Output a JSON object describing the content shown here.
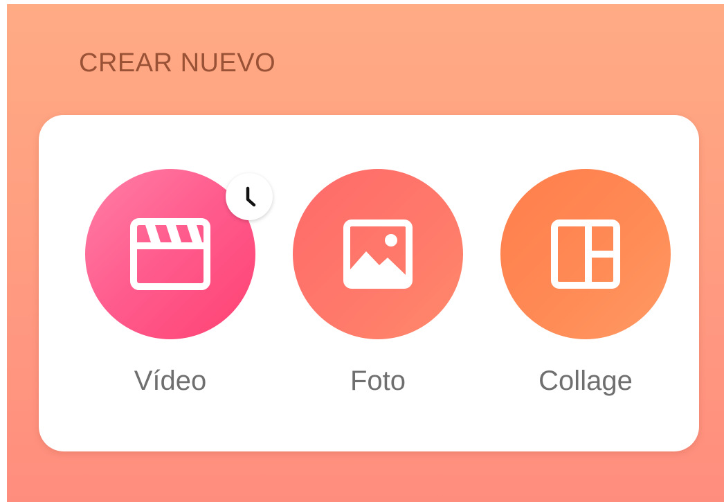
{
  "section": {
    "title": "CREAR NUEVO"
  },
  "options": [
    {
      "label": "Vídeo",
      "icon": "clapperboard-icon",
      "color": "#ff5a8c",
      "badge_icon": "clock-icon"
    },
    {
      "label": "Foto",
      "icon": "image-icon",
      "color": "#ff6f6a"
    },
    {
      "label": "Collage",
      "icon": "collage-layout-icon",
      "color": "#ff8a55"
    }
  ]
}
